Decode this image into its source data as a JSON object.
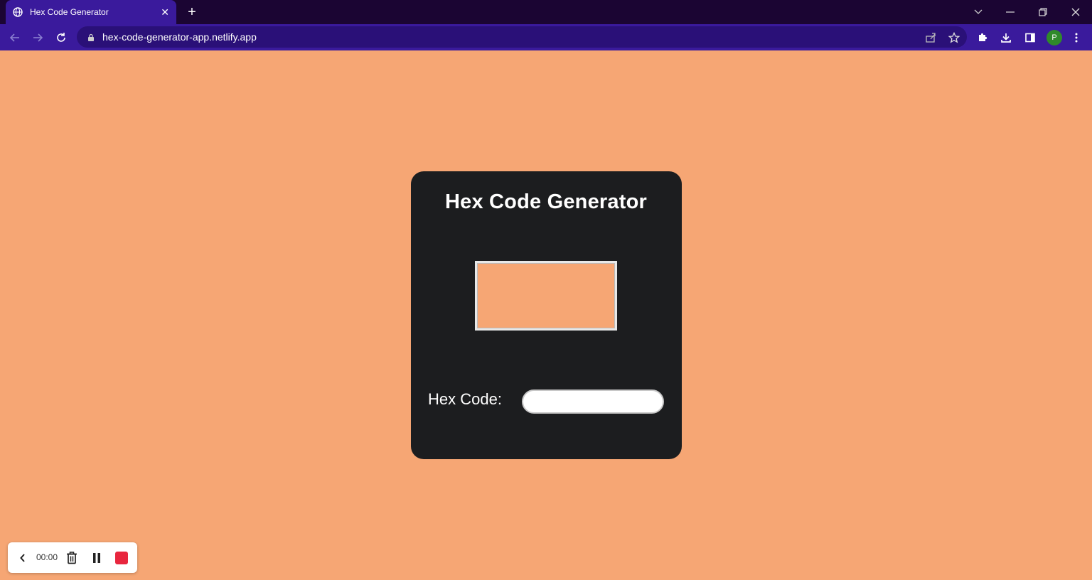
{
  "browser": {
    "tab_title": "Hex Code Generator",
    "tab_close": "✕",
    "new_tab": "+",
    "url": "hex-code-generator-app.netlify.app",
    "profile_initial": "P"
  },
  "app": {
    "title": "Hex Code Generator",
    "hex_label": "Hex Code:",
    "hex_value": "",
    "swatch_color": "#f6a674",
    "page_background": "#f6a674",
    "card_color": "#1c1d1f"
  },
  "recorder": {
    "time": "00:00"
  },
  "icons": [
    "globe-icon",
    "close-icon",
    "plus-icon",
    "chevron-down-icon",
    "minimize-icon",
    "restore-icon",
    "window-close-icon",
    "back-arrow-icon",
    "forward-arrow-icon",
    "reload-icon",
    "lock-icon",
    "share-icon",
    "star-icon",
    "puzzle-icon",
    "download-icon",
    "side-panel-icon",
    "more-icon",
    "chevron-left-icon",
    "trash-icon",
    "pause-icon",
    "stop-icon"
  ]
}
